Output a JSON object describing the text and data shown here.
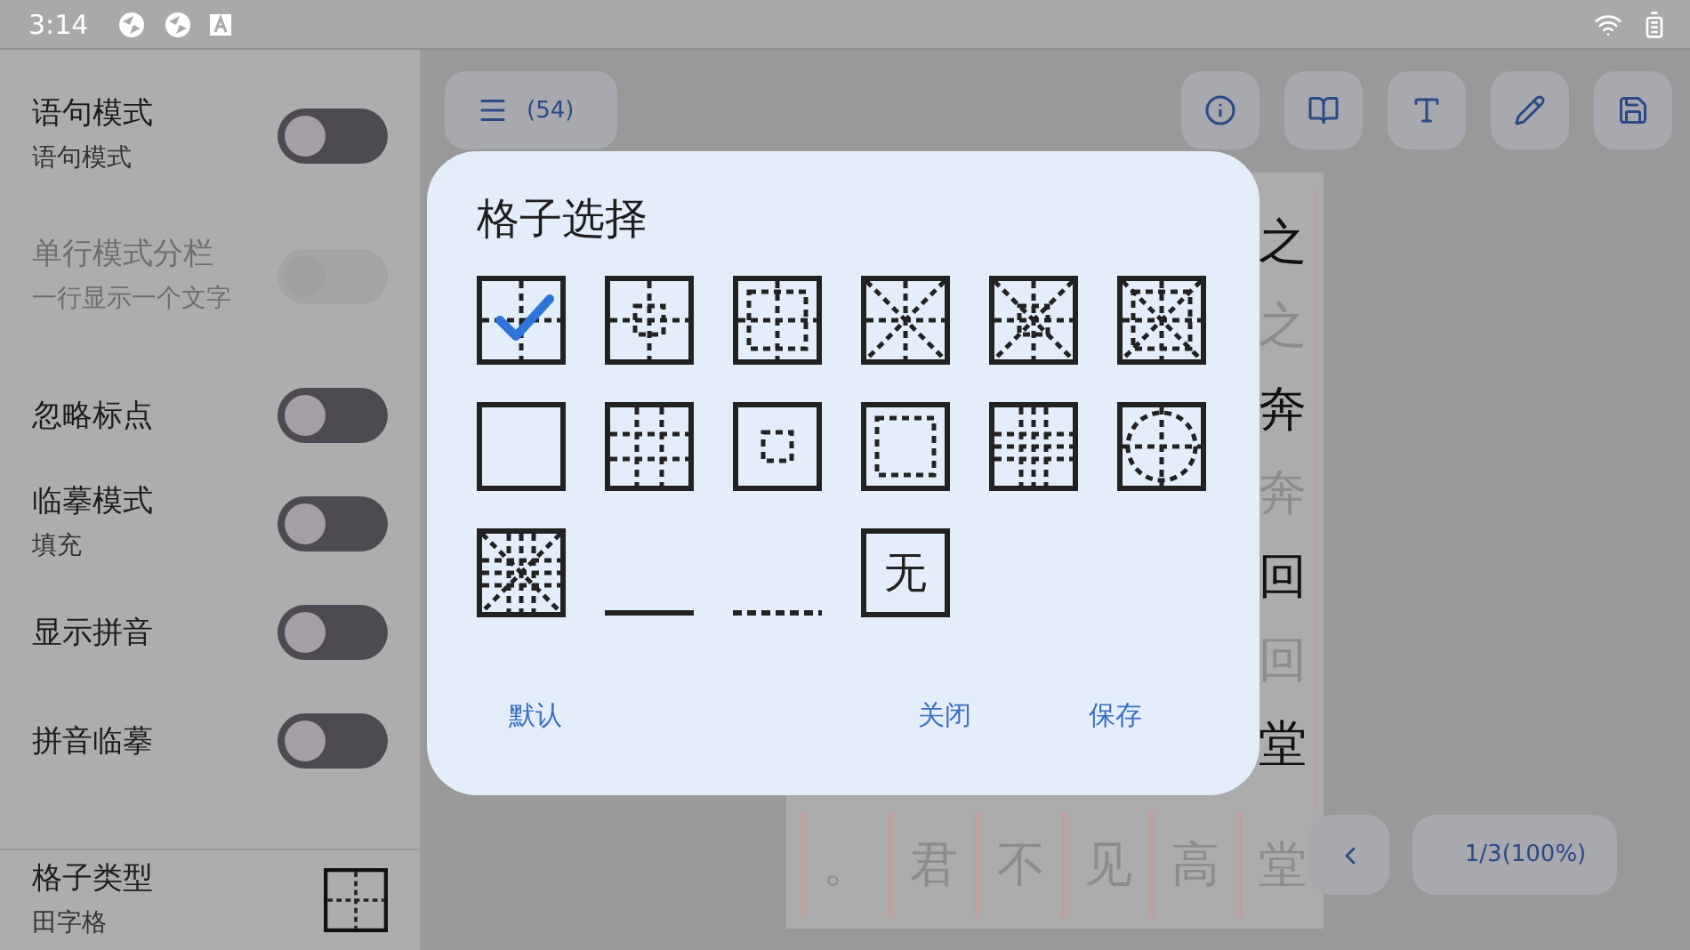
{
  "status_bar": {
    "time": "3:14"
  },
  "settings": [
    {
      "kind": "toggle",
      "title": "语句模式",
      "subtitle": "语句模式",
      "on": false,
      "disabled": false
    },
    {
      "kind": "toggle",
      "title": "单行模式分栏",
      "subtitle": "一行显示一个文字",
      "on": false,
      "disabled": true
    },
    {
      "kind": "toggle",
      "title": "忽略标点",
      "on": false,
      "disabled": false
    },
    {
      "kind": "toggle",
      "title": "临摹模式",
      "subtitle": "填充",
      "on": false,
      "disabled": false
    },
    {
      "kind": "toggle",
      "title": "显示拼音",
      "on": false,
      "disabled": false
    },
    {
      "kind": "toggle",
      "title": "拼音临摹",
      "on": false,
      "disabled": false
    },
    {
      "kind": "grid_type",
      "title": "格子类型",
      "subtitle": "田字格"
    }
  ],
  "toolbar": {
    "count": "(54)"
  },
  "paper": {
    "column": [
      {
        "char": "之",
        "faded": false
      },
      {
        "char": "之",
        "faded": true
      },
      {
        "char": "奔",
        "faded": false
      },
      {
        "char": "奔",
        "faded": true
      },
      {
        "char": "回",
        "faded": false
      },
      {
        "char": "回",
        "faded": true
      },
      {
        "char": "堂",
        "faded": false
      }
    ],
    "bottom_row": [
      {
        "char": "。",
        "faded": true
      },
      {
        "char": "君",
        "faded": true
      },
      {
        "char": "不",
        "faded": true
      },
      {
        "char": "见",
        "faded": true
      },
      {
        "char": "高",
        "faded": true
      },
      {
        "char": "堂",
        "faded": true
      }
    ]
  },
  "pager": {
    "reading": "1/3(100%)"
  },
  "dialog": {
    "title": "格子选择",
    "options": [
      {
        "kind": "tian",
        "selected": true
      },
      {
        "kind": "tian_center",
        "selected": false
      },
      {
        "kind": "tian_inset",
        "selected": false
      },
      {
        "kind": "mi",
        "selected": false
      },
      {
        "kind": "mi_center",
        "selected": false
      },
      {
        "kind": "mi_inset",
        "selected": false
      },
      {
        "kind": "blank",
        "selected": false
      },
      {
        "kind": "jing",
        "selected": false
      },
      {
        "kind": "center_square",
        "selected": false
      },
      {
        "kind": "inset_square",
        "selected": false
      },
      {
        "kind": "jing_tian",
        "selected": false
      },
      {
        "kind": "tian_circle",
        "selected": false
      },
      {
        "kind": "mi_jing",
        "selected": false
      },
      {
        "kind": "underline",
        "selected": false
      },
      {
        "kind": "dashed_underline",
        "selected": false
      },
      {
        "kind": "none",
        "selected": false,
        "label": "无"
      }
    ],
    "buttons": [
      "默认",
      "关闭",
      "保存"
    ]
  }
}
